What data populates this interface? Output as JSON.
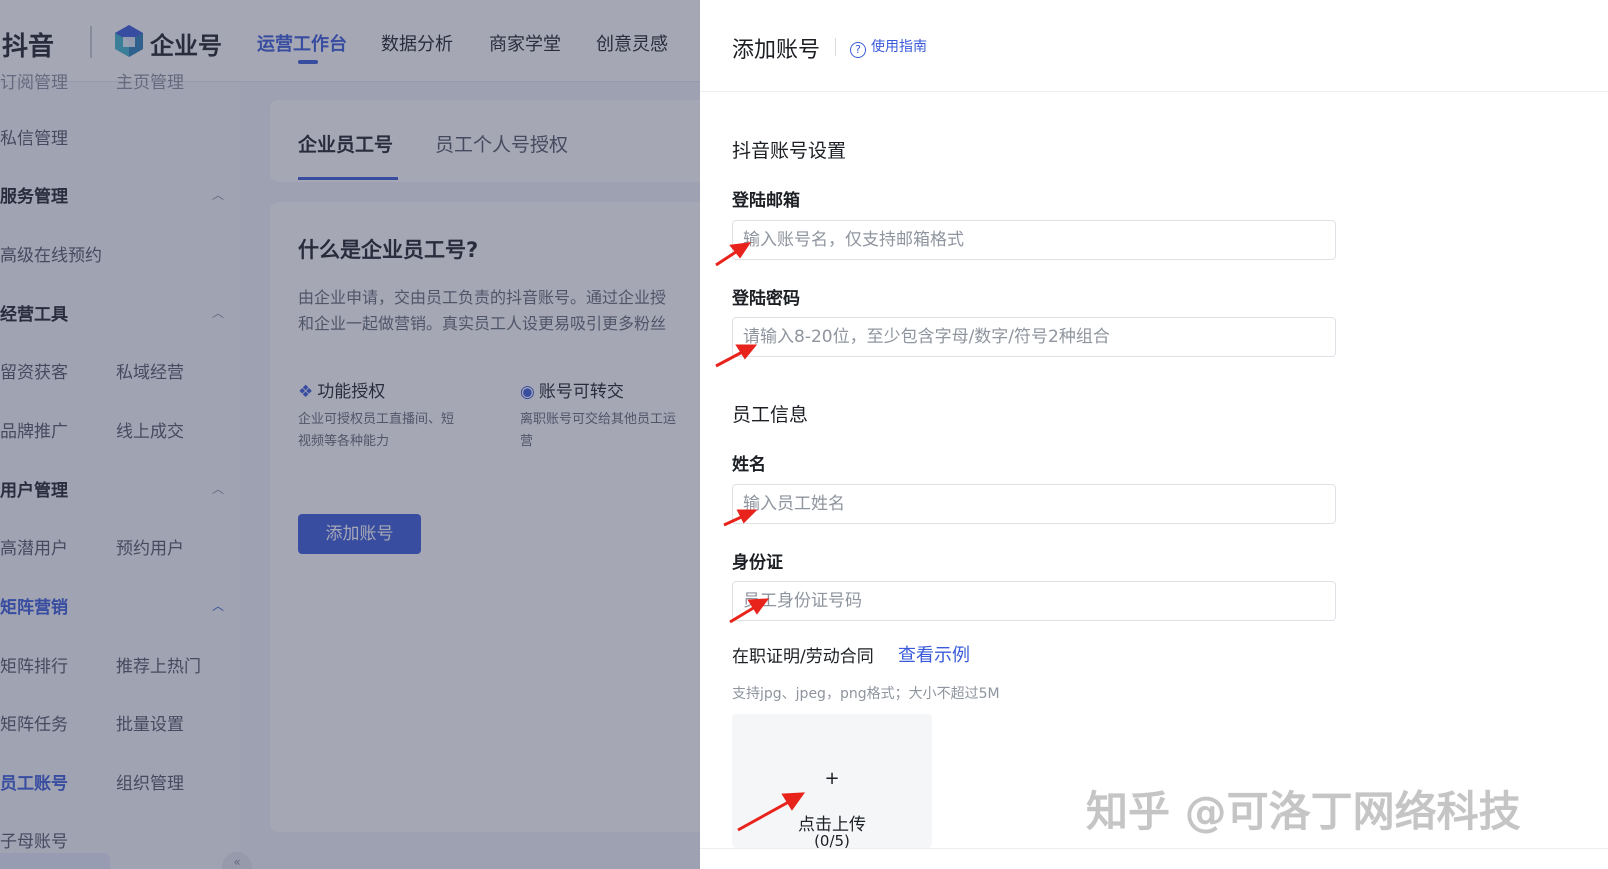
{
  "header": {
    "brand_douyin": "抖音",
    "brand_enterprise": "企业号",
    "nav": [
      {
        "label": "运营工作台",
        "active": true
      },
      {
        "label": "数据分析",
        "active": false
      },
      {
        "label": "商家学堂",
        "active": false
      },
      {
        "label": "创意灵感",
        "active": false
      }
    ]
  },
  "sidebar": {
    "cut_top_left": "订阅管理",
    "cut_top_right": "主页管理",
    "items": {
      "private_msg": "私信管理",
      "group_service": "服务管理",
      "advanced_booking": "高级在线预约",
      "group_tools": "经营工具",
      "lead_capture": "留资获客",
      "private_domain": "私域经营",
      "brand_promo": "品牌推广",
      "online_deal": "线上成交",
      "group_users": "用户管理",
      "potential_users": "高潜用户",
      "booked_users": "预约用户",
      "group_matrix": "矩阵营销",
      "matrix_rank": "矩阵排行",
      "recommend_hot": "推荐上热门",
      "matrix_task": "矩阵任务",
      "batch_settings": "批量设置",
      "employee_account": "员工账号",
      "org_manage": "组织管理",
      "sub_account": "子母账号"
    }
  },
  "tabs": [
    "企业员工号",
    "员工个人号授权"
  ],
  "intro": {
    "title": "什么是企业员工号?",
    "desc_line1": "由企业申请，交由员工负责的抖音账号。通过企业授",
    "desc_line2": "和企业一起做营销。真实员工人设更易吸引更多粉丝",
    "feature1": {
      "title": "功能授权",
      "desc_line1": "企业可授权员工直播间、短",
      "desc_line2": "视频等各种能力"
    },
    "feature2": {
      "title": "账号可转交",
      "desc_line1": "离职账号可交给其他员工运",
      "desc_line2": "营"
    },
    "button": "添加账号"
  },
  "drawer": {
    "title": "添加账号",
    "guide_link": "使用指南",
    "guide_icon": "question-circle-icon",
    "section_account": "抖音账号设置",
    "email_label": "登陆邮箱",
    "email_placeholder": "输入账号名，仅支持邮箱格式",
    "password_label": "登陆密码",
    "password_placeholder": "请输入8-20位，至少包含字母/数字/符号2种组合",
    "section_employee": "员工信息",
    "name_label": "姓名",
    "name_placeholder": "输入员工姓名",
    "id_label": "身份证",
    "id_placeholder": "员工身份证号码",
    "cert_label": "在职证明/劳动合同",
    "example_link": "查看示例",
    "upload_hint": "支持jpg、jpeg，png格式；大小不超过5M",
    "upload_plus": "+",
    "upload_label": "点击上传",
    "upload_count": "(0/5)"
  },
  "watermark": "知乎 @可洛丁网络科技",
  "colors": {
    "accent": "#3a5bd9",
    "annotation_arrow": "#e8231b",
    "overlay": "#383c5c"
  }
}
